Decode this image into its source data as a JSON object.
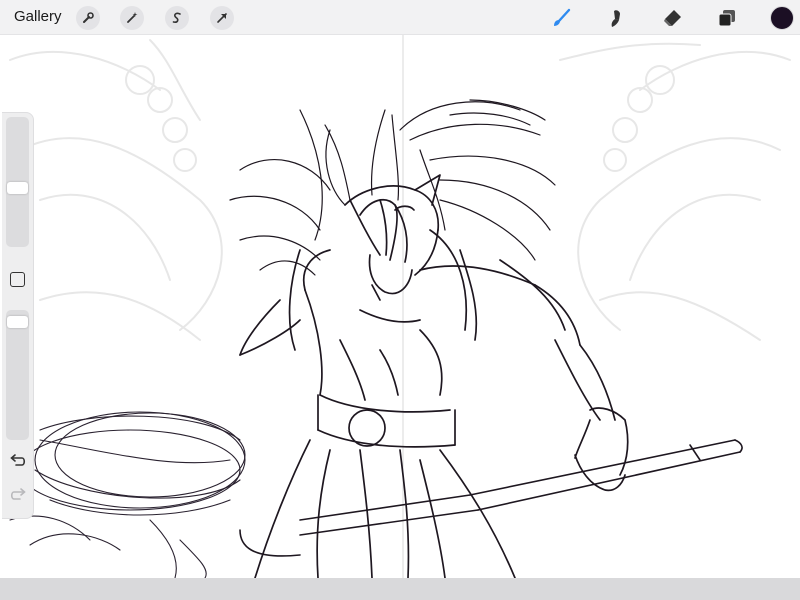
{
  "toolbar": {
    "gallery_label": "Gallery",
    "left_tools": [
      "wrench-icon",
      "magic-wand-icon",
      "selection-s-icon",
      "transform-arrow-icon"
    ],
    "right_tools": [
      "brush-icon",
      "smudge-icon",
      "eraser-icon",
      "layers-icon"
    ],
    "active_tool": "brush",
    "accent_color": "#2f8bf0",
    "current_color": "#1b0f24"
  },
  "sidebar": {
    "size_slider_level": 0.45,
    "opacity_slider_level": 0.05,
    "undo_icon": "undo-icon",
    "redo_icon": "redo-icon",
    "modify_icon": "square-modify-icon"
  },
  "canvas": {
    "background": "#ffffff",
    "sketch_color": "#1e1720",
    "ghost_color": "#e6e6e6"
  }
}
